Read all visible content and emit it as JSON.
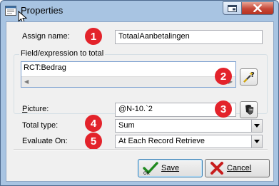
{
  "window": {
    "title": "Properties"
  },
  "form": {
    "assign_name_label": "Assign name:",
    "assign_name_value": "TotaalAanbetalingen",
    "group_title": "Field/expression to total",
    "expression_value": "RCT:Bedrag",
    "picture_label": "Picture:",
    "picture_value": "@N-10.`2",
    "total_type_label": "Total type:",
    "total_type_value": "Sum",
    "evaluate_on_label": "Evaluate On:",
    "evaluate_on_value": "At Each Record Retrieve"
  },
  "badges": [
    "1",
    "2",
    "3",
    "4",
    "5"
  ],
  "buttons": {
    "save": "Save",
    "cancel": "Cancel"
  },
  "colors": {
    "badge": "#e3232b",
    "title_bar": "#a8c4e2",
    "close_button": "#c64737"
  },
  "icons": [
    "app-icon",
    "cursor-icon",
    "restore-icon",
    "close-icon",
    "magic-wand-icon",
    "mask-icon",
    "checkmark-icon",
    "cancel-x-icon",
    "dropdown-arrow-icon"
  ]
}
